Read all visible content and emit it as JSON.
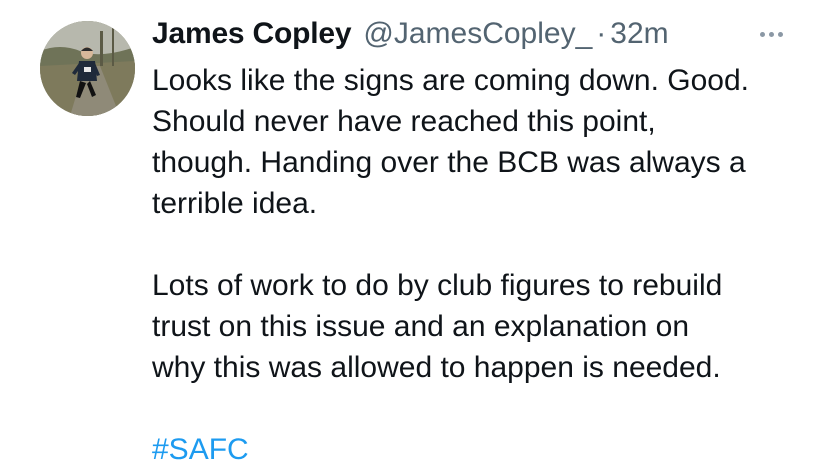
{
  "tweet": {
    "author_name": "James Copley",
    "handle": "@JamesCopley_",
    "separator": "·",
    "time": "32m",
    "paragraphs": [
      [
        "Looks like the signs are coming down. Good.",
        "Should never have reached this point,",
        "though. Handing over the BCB was always a",
        "terrible idea."
      ],
      [
        "Lots of work to do by club figures to rebuild",
        "trust on this issue and an explanation on",
        "why this was allowed to happen is needed."
      ]
    ],
    "hashtag": "#SAFC",
    "more_icon": "more-horizontal-icon",
    "colors": {
      "text": "#0f1419",
      "secondary": "#536471",
      "link": "#1d9bf0"
    }
  }
}
